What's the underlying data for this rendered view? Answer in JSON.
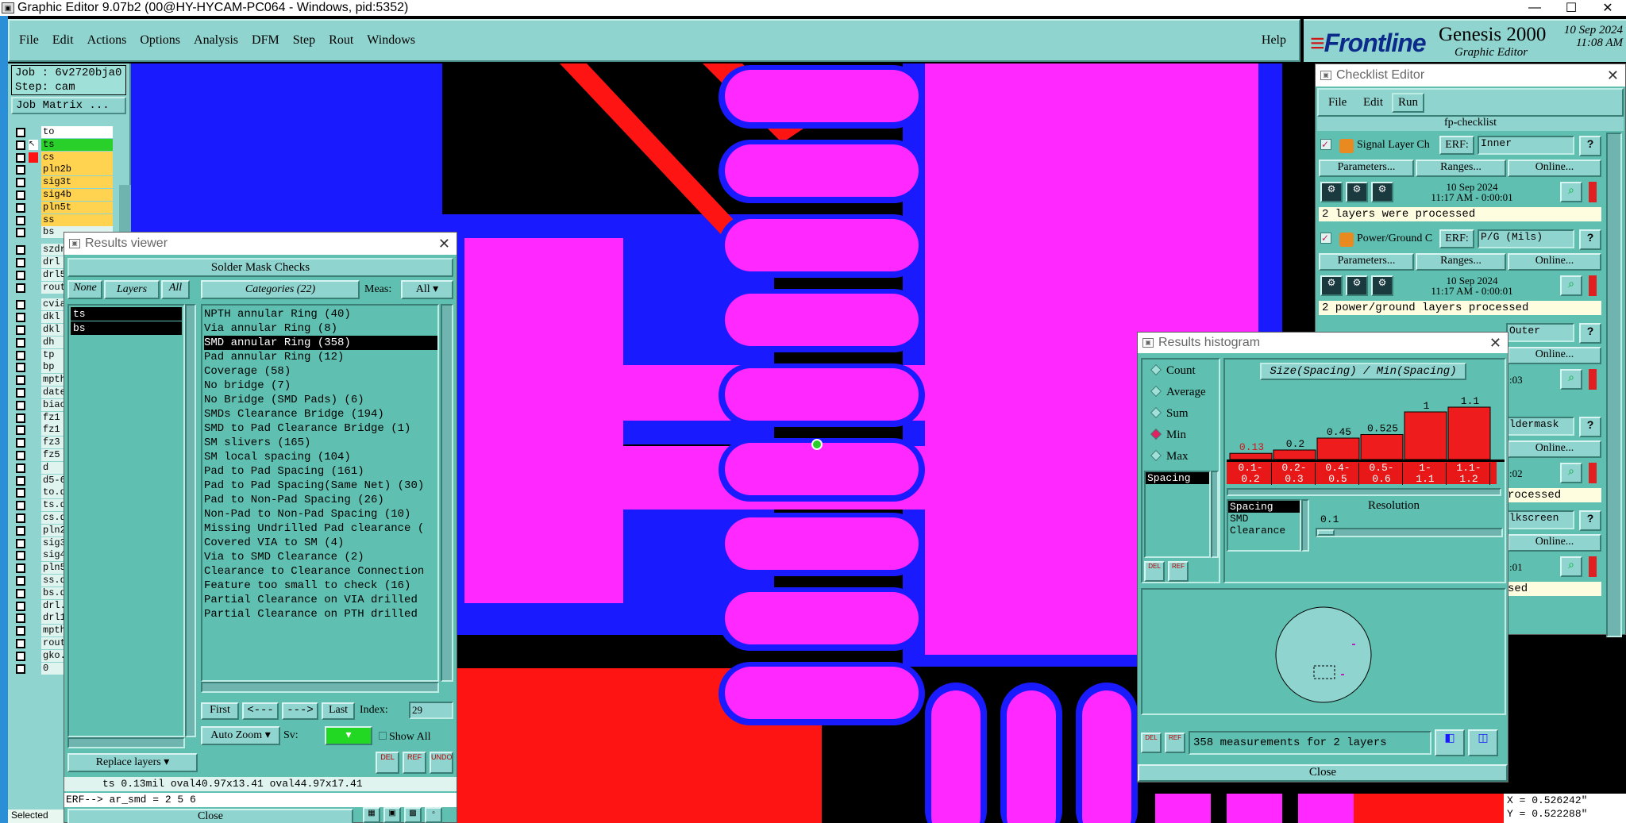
{
  "window": {
    "title": "Graphic Editor 9.07b2 (00@HY-HYCAM-PC064 - Windows, pid:5352)",
    "minimize": "—",
    "maximize": "☐",
    "close": "✕"
  },
  "menu": {
    "items": [
      "File",
      "Edit",
      "Actions",
      "Options",
      "Analysis",
      "DFM",
      "Step",
      "Rout",
      "Windows"
    ],
    "help": "Help"
  },
  "brand": {
    "logo": "Frontline",
    "product": "Genesis 2000",
    "subtitle": "Graphic Editor",
    "date_line1": "10 Sep 2024",
    "date_line2": "11:08 AM"
  },
  "job": {
    "job_label": "Job : 6v2720bja0",
    "step_label": "Step: cam",
    "job_matrix_button": "Job Matrix ..."
  },
  "layers": [
    "to",
    "ts",
    "cs",
    "pln2b",
    "sig3t",
    "sig4b",
    "pln5t",
    "ss",
    "bs",
    "szdr",
    "drl",
    "drl5",
    "rout",
    "cvia",
    "dkl",
    "dkl",
    "dh",
    "tp",
    "bp",
    "mpth",
    "date",
    "biao",
    "fz1",
    "fz1",
    "fz3",
    "fz5",
    "d",
    "d5-6",
    "to.d",
    "ts.d",
    "cs.d",
    "pln2",
    "sig3",
    "sig4",
    "pln5",
    "ss.d",
    "bs.d",
    "drl.",
    "drl1",
    "mpth",
    "rout",
    "gko.",
    "0"
  ],
  "status_bar": {
    "selected": "Selected"
  },
  "results_viewer": {
    "title": "Results viewer",
    "header": "Solder Mask Checks",
    "none_button": "None",
    "layers_button": "Layers",
    "all_button": "All",
    "categories_button": "Categories (22)",
    "meas_label": "Meas:",
    "meas_value": "All",
    "layers": [
      "ts",
      "bs"
    ],
    "categories": [
      "NPTH annular Ring (40)",
      "Via annular Ring (8)",
      "SMD annular Ring (358)",
      "Pad annular Ring (12)",
      "Coverage (58)",
      "No bridge (7)",
      "No Bridge (SMD Pads) (6)",
      "SMDs Clearance Bridge (194)",
      "SMD to Pad Clearance Bridge (1)",
      "SM slivers (165)",
      "SM local spacing (104)",
      "Pad to Pad Spacing (161)",
      "Pad to Pad Spacing(Same Net) (30)",
      "Pad to Non-Pad Spacing (26)",
      "Non-Pad to Non-Pad Spacing (10)",
      "Missing Undrilled Pad clearance (",
      "Covered VIA to SM (4)",
      "Via to SMD Clearance (2)",
      "Clearance to Clearance Connection",
      "Feature too small to check (16)",
      "Partial Clearance on VIA drilled",
      "Partial Clearance on PTH drilled"
    ],
    "first_button": "First",
    "prev_button": "<---",
    "next_button": "--->",
    "last_button": "Last",
    "index_label": "Index:",
    "index_value": "29",
    "auto_zoom": "Auto Zoom",
    "sv_label": "Sv:",
    "show_all": "Show All",
    "replace_layers": "Replace layers",
    "del_label": "DEL",
    "ref_label": "REF",
    "undo_label": "UNDO",
    "status_line": "ts 0.13mil   oval40.97x13.41   oval44.97x17.41",
    "erf_line": "ERF--> ar_smd = 2 5 6",
    "close_button": "Close"
  },
  "checklist": {
    "title": "Checklist Editor",
    "menu": [
      "File",
      "Edit",
      "Run"
    ],
    "name": "fp-checklist",
    "erf_label": "ERF:",
    "params_button": "Parameters...",
    "ranges_button": "Ranges...",
    "online_button": "Online...",
    "help_button": "?",
    "items": [
      {
        "name": "Signal Layer Ch",
        "erf": "Inner",
        "date": "10 Sep 2024",
        "time": "11:17 AM - 0:00:01",
        "message": "2 layers were processed"
      },
      {
        "name": "Power/Ground C",
        "erf": "P/G (Mils)",
        "date": "10 Sep 2024",
        "time": "11:17 AM - 0:00:01",
        "message": "2 power/ground layers processed"
      }
    ],
    "partial": {
      "erf3": "Outer",
      "t3": ":03",
      "erf4": "ldermask",
      "t4": ":02",
      "msg4": "rocessed",
      "erf5": "lkscreen",
      "t5": ":01",
      "msg5": "sed"
    }
  },
  "histogram": {
    "title": "Results histogram",
    "radios": [
      "Count",
      "Average",
      "Sum",
      "Min",
      "Max"
    ],
    "selected_radio": "Min",
    "measure_list": [
      "Spacing"
    ],
    "chart_title": "Size(Spacing) / Min(Spacing)",
    "resolution_label": "Resolution",
    "resolution_value": "0.1",
    "axis_list": [
      "Spacing",
      "SMD",
      "Clearance"
    ],
    "del_label": "DEL",
    "ref_label": "REF",
    "measurements": "358 measurements for 2 layers",
    "close_button": "Close"
  },
  "chart_data": {
    "type": "bar",
    "title": "Size(Spacing) / Min(Spacing)",
    "categories": [
      "0.1-0.2",
      "0.2-0.3",
      "0.4-0.5",
      "0.5-0.6",
      "1-1.1",
      "1.1-1.2"
    ],
    "tick_top": [
      "0.1-",
      "0.2-",
      "0.4-",
      "0.5-",
      "1-",
      "1.1-"
    ],
    "tick_bottom": [
      "0.2",
      "0.3",
      "0.5",
      "0.6",
      "1.1",
      "1.2"
    ],
    "values": [
      0.13,
      0.2,
      0.45,
      0.525,
      1,
      1.1
    ],
    "labels": [
      "0.13",
      "0.2",
      "0.45",
      "0.525",
      "1",
      "1.1"
    ],
    "ylim": [
      0,
      1.2
    ],
    "bar_color": "#ee1c1c",
    "highlight_label_color": "#d01818"
  },
  "coords": {
    "x": "X = 0.526242\"",
    "y": "Y = 0.522288\""
  },
  "colors": {
    "panel": "#8fd4cf",
    "layer_highlight": "#ffd34f",
    "cad_magenta": "#ff28ff",
    "cad_red": "#ff1414",
    "cad_blue": "#1a1aff"
  }
}
